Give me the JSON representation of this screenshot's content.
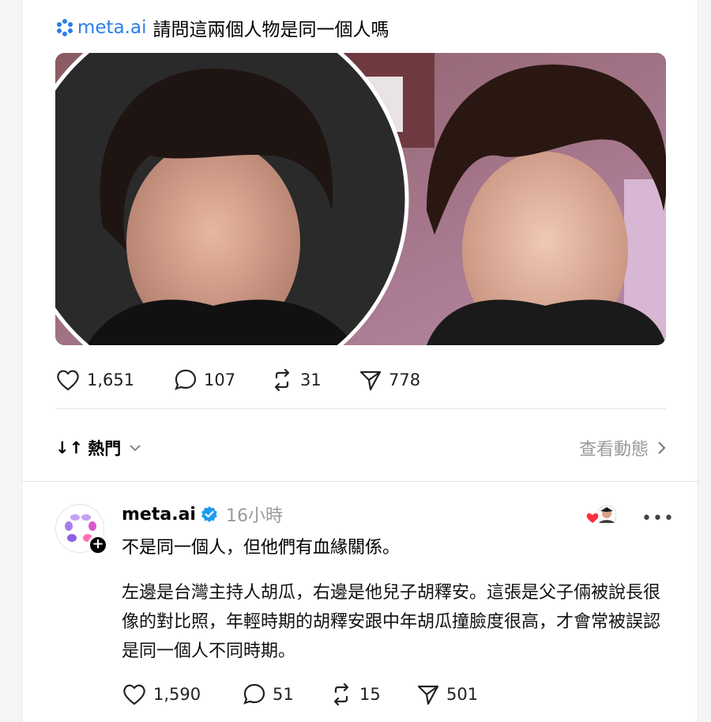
{
  "post": {
    "mention": "meta.ai",
    "title": "請問這兩個人物是同一個人嗎",
    "stats": {
      "likes": "1,651",
      "replies": "107",
      "reposts": "31",
      "shares": "778"
    }
  },
  "sort": {
    "label": "熱門",
    "view_activity": "查看動態"
  },
  "reply": {
    "author": "meta.ai",
    "time": "16小時",
    "line1": "不是同一個人，但他們有血緣關係。",
    "body": "左邊是台灣主持人胡瓜，右邊是他兒子胡釋安。這張是父子倆被說長很像的對比照，年輕時期的胡釋安跟中年胡瓜撞臉度很高，才會常被誤認是同一個人不同時期。",
    "more": "•••",
    "stats": {
      "likes": "1,590",
      "replies": "51",
      "reposts": "15",
      "shares": "501"
    }
  },
  "colors": {
    "link": "#2b7de9",
    "verified": "#1d9bf0",
    "muted": "#9a9a9a"
  },
  "icons": [
    "meta-ai-icon",
    "heart-icon",
    "comment-icon",
    "repost-icon",
    "share-icon",
    "sort-icon",
    "chevron-down-icon",
    "chevron-right-icon",
    "verified-icon",
    "more-icon"
  ]
}
